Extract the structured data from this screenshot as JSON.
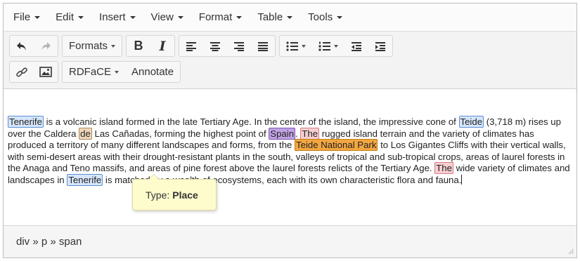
{
  "menubar": {
    "items": [
      "File",
      "Edit",
      "Insert",
      "View",
      "Format",
      "Table",
      "Tools"
    ]
  },
  "toolbar": {
    "formats_label": "Formats",
    "bold_label": "B",
    "italic_label": "I",
    "rdface_label": "RDFaCE",
    "annotate_label": "Annotate"
  },
  "content": {
    "segments": [
      {
        "t": "Tenerife",
        "a": "blue"
      },
      {
        "t": " is a volcanic island formed in the late Tertiary Age. In the center of the island, the impressive cone of "
      },
      {
        "t": "Teide",
        "a": "blue"
      },
      {
        "t": " (3,718 m) rises up over the Caldera "
      },
      {
        "t": "de",
        "a": "tan"
      },
      {
        "t": " Las Cañadas, forming the highest point of "
      },
      {
        "t": "Spain",
        "a": "purple"
      },
      {
        "t": ". "
      },
      {
        "t": "The",
        "a": "pink"
      },
      {
        "t": " rugged island terrain and the variety of climates has produced a territory of many different landscapes and forms, from the "
      },
      {
        "t": "Teide National Park",
        "a": "orange"
      },
      {
        "t": " to Los Gigantes Cliffs with their vertical walls, with semi-desert areas with their drought-resistant plants in the south, valleys of tropical and sub-tropical crops, areas of laurel forests in the Anaga and Teno massifs, and areas of pine forest above the laurel forests relicts of the Tertiary Age. "
      },
      {
        "t": "The",
        "a": "pink"
      },
      {
        "t": " wide variety of climates and landscapes in "
      },
      {
        "t": "Tenerife",
        "a": "blue"
      },
      {
        "t": " is matched by a wealth of ecosystems, each with its own characteristic flora and fauna."
      }
    ]
  },
  "tooltip": {
    "label": "Type:",
    "value": "Place"
  },
  "statusbar": {
    "path": "div » p » span"
  },
  "colors": {
    "annotation_blue": "#d6e6fa",
    "annotation_orange": "#f3a741",
    "annotation_purple": "#c2a3e3",
    "annotation_pink": "#f6cfd1",
    "annotation_tan": "#efd8bb",
    "tooltip_bg": "#fefccd"
  }
}
